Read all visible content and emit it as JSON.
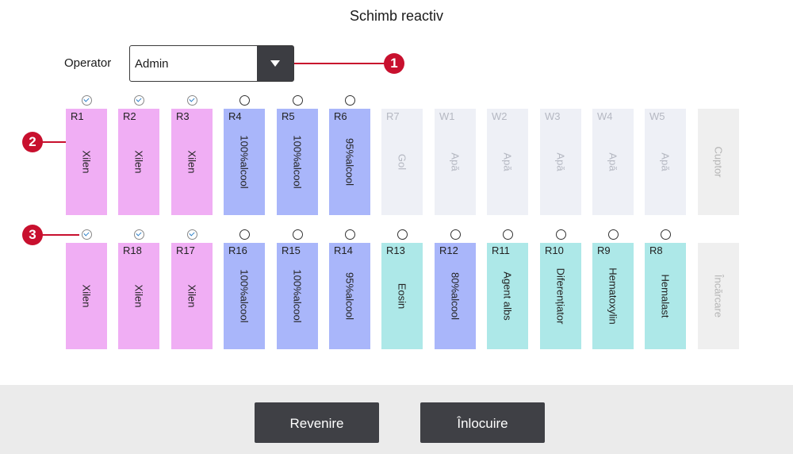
{
  "title": "Schimb reactiv",
  "operator": {
    "label": "Operator",
    "value": "Admin"
  },
  "callouts": [
    "1",
    "2",
    "3"
  ],
  "top_row": [
    {
      "id": "R1",
      "name": "Xilen",
      "color": "pink",
      "checked": true
    },
    {
      "id": "R2",
      "name": "Xilen",
      "color": "pink",
      "checked": true
    },
    {
      "id": "R3",
      "name": "Xilen",
      "color": "pink",
      "checked": true
    },
    {
      "id": "R4",
      "name": "100%alcool",
      "color": "blue",
      "checked": false
    },
    {
      "id": "R5",
      "name": "100%alcool",
      "color": "blue",
      "checked": false
    },
    {
      "id": "R6",
      "name": "95%alcool",
      "color": "blue",
      "checked": false
    },
    {
      "id": "R7",
      "name": "Gol",
      "color": "empty"
    },
    {
      "id": "W1",
      "name": "Apă",
      "color": "empty"
    },
    {
      "id": "W2",
      "name": "Apă",
      "color": "empty"
    },
    {
      "id": "W3",
      "name": "Apă",
      "color": "empty"
    },
    {
      "id": "W4",
      "name": "Apă",
      "color": "empty"
    },
    {
      "id": "W5",
      "name": "Apă",
      "color": "empty"
    },
    {
      "id": "",
      "name": "Cuptor",
      "color": "gray"
    }
  ],
  "bottom_row": [
    {
      "id": "",
      "name": "Xilen",
      "color": "pink",
      "checked": true
    },
    {
      "id": "R18",
      "name": "Xilen",
      "color": "pink",
      "checked": true
    },
    {
      "id": "R17",
      "name": "Xilen",
      "color": "pink",
      "checked": true
    },
    {
      "id": "R16",
      "name": "100%alcool",
      "color": "blue",
      "checked": false
    },
    {
      "id": "R15",
      "name": "100%alcool",
      "color": "blue",
      "checked": false
    },
    {
      "id": "R14",
      "name": "95%alcool",
      "color": "blue",
      "checked": false
    },
    {
      "id": "R13",
      "name": "Eosin",
      "color": "teal",
      "checked": false
    },
    {
      "id": "R12",
      "name": "80%alcool",
      "color": "blue",
      "checked": false
    },
    {
      "id": "R11",
      "name": "Agent albs",
      "color": "teal",
      "checked": false
    },
    {
      "id": "R10",
      "name": "Diferențiator",
      "color": "teal",
      "checked": false
    },
    {
      "id": "R9",
      "name": "Hematoxylin",
      "color": "teal",
      "checked": false
    },
    {
      "id": "R8",
      "name": "Hemalast",
      "color": "teal",
      "checked": false
    },
    {
      "id": "",
      "name": "Încărcare",
      "color": "gray"
    }
  ],
  "buttons": {
    "back": "Revenire",
    "replace": "Înlocuire"
  },
  "colors": {
    "callout": "#c8102e",
    "pink": "#f0aef4",
    "blue": "#a9b6fa",
    "teal": "#ade8e8",
    "button": "#3f4045"
  }
}
